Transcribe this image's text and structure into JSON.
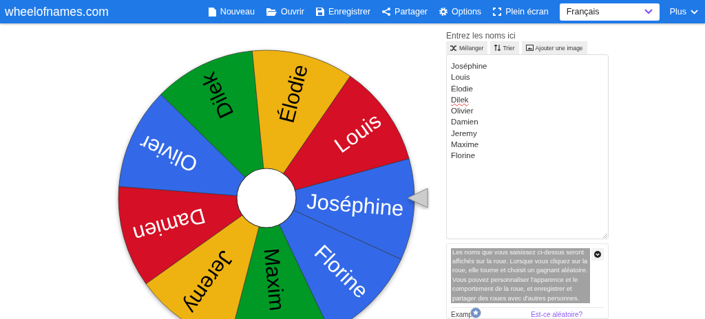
{
  "header": {
    "logo": "wheelofnames.com",
    "menu": [
      {
        "label": "Nouveau"
      },
      {
        "label": "Ouvrir"
      },
      {
        "label": "Enregistrer"
      },
      {
        "label": "Partager"
      },
      {
        "label": "Options"
      },
      {
        "label": "Plein écran"
      }
    ],
    "language": "Français",
    "more": "Plus"
  },
  "wheel": {
    "segments": [
      {
        "name": "Joséphine",
        "color": "#3369e8"
      },
      {
        "name": "Florine",
        "color": "#3369e8"
      },
      {
        "name": "Maxim",
        "color": "#009925"
      },
      {
        "name": "Jeremy",
        "color": "#eeb211"
      },
      {
        "name": "Damien",
        "color": "#d50f25"
      },
      {
        "name": "Olivier",
        "color": "#3369e8"
      },
      {
        "name": "Dilek",
        "color": "#009925"
      },
      {
        "name": "Élodie",
        "color": "#eeb211"
      },
      {
        "name": "Louis",
        "color": "#d50f25"
      }
    ]
  },
  "entries": {
    "title": "Entrez les noms ici",
    "tools": [
      {
        "label": "Mélanger"
      },
      {
        "label": "Trier"
      },
      {
        "label": "Ajouter une image"
      }
    ],
    "names": [
      {
        "text": "Joséphine",
        "misspelled": false
      },
      {
        "text": "Louis",
        "misspelled": false
      },
      {
        "text": "Élodie",
        "misspelled": false
      },
      {
        "text": "Dilek",
        "misspelled": true
      },
      {
        "text": "Olivier",
        "misspelled": false
      },
      {
        "text": "Damien",
        "misspelled": false
      },
      {
        "text": "Jeremy",
        "misspelled": false
      },
      {
        "text": "Maxime",
        "misspelled": false
      },
      {
        "text": "Florine",
        "misspelled": false
      }
    ]
  },
  "info": {
    "text": "Les noms que vous saisissez ci-dessus seront affichés sur la roue. Lorsque vous cliquez sur la roue, elle tourne et choisit un gagnant aléatoire. Vous pouvez personnaliser l'apparence et le comportement de la roue, et enregistrer et partager des roues avec d'autres personnes.",
    "highlighted": true,
    "tab": "Examp",
    "link": "Est-ce aléatoire?"
  }
}
